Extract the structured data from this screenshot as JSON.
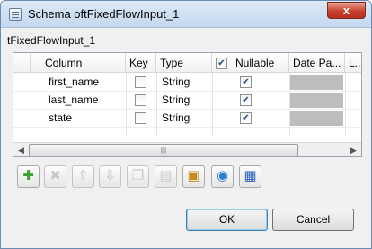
{
  "window": {
    "title": "Schema oftFixedFlowInput_1",
    "close_label": "x"
  },
  "panel": {
    "label": "tFixedFlowInput_1"
  },
  "table": {
    "columns": [
      "Column",
      "Key",
      "Type",
      "Nullable",
      "Date Pa...",
      "L..."
    ],
    "header_nullable_checked": true,
    "rows": [
      {
        "column": "first_name",
        "key": false,
        "type": "String",
        "nullable": true
      },
      {
        "column": "last_name",
        "key": false,
        "type": "String",
        "nullable": true
      },
      {
        "column": "state",
        "key": false,
        "type": "String",
        "nullable": true
      }
    ]
  },
  "toolbar": {
    "buttons": [
      {
        "icon": "add-icon",
        "enabled": true
      },
      {
        "icon": "remove-icon",
        "enabled": false
      },
      {
        "icon": "move-up-icon",
        "enabled": false
      },
      {
        "icon": "move-down-icon",
        "enabled": false
      },
      {
        "icon": "copy-icon",
        "enabled": false
      },
      {
        "icon": "paste-icon",
        "enabled": false
      },
      {
        "icon": "import-icon",
        "enabled": true
      },
      {
        "icon": "export-icon",
        "enabled": true
      },
      {
        "icon": "save-icon",
        "enabled": true
      }
    ]
  },
  "buttons": {
    "ok": "OK",
    "cancel": "Cancel"
  },
  "colors": {
    "titlebar": "#c4d8ee",
    "close": "#c8412e",
    "add_green": "#3aa12f",
    "save_blue": "#2b5fb8"
  }
}
